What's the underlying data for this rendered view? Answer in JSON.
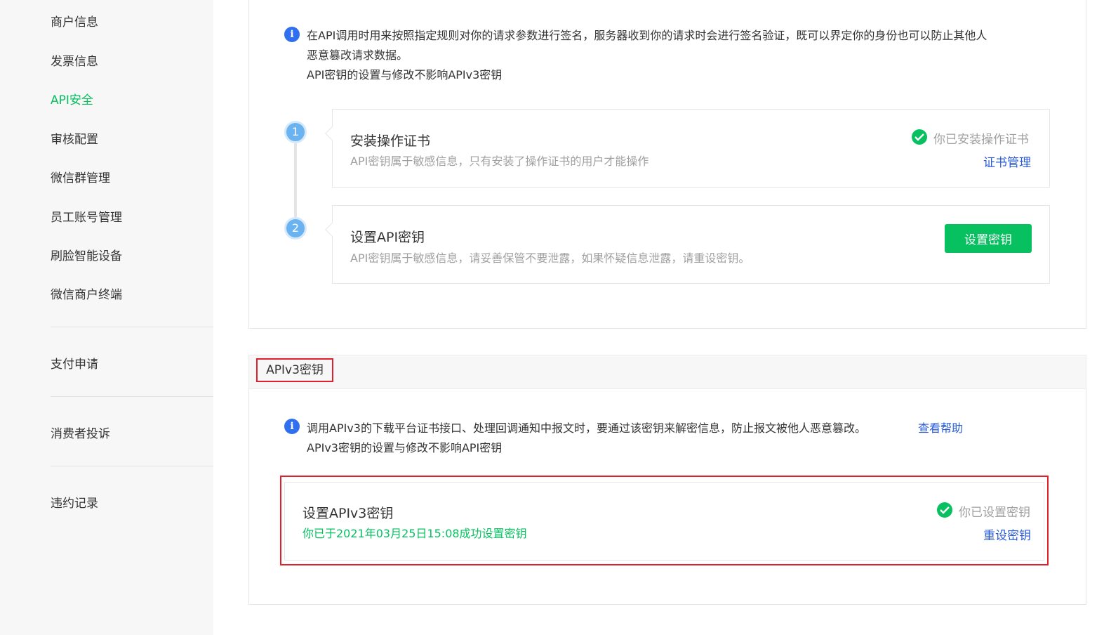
{
  "sidebar": {
    "items": [
      {
        "label": "商户信息",
        "active": false
      },
      {
        "label": "发票信息",
        "active": false
      },
      {
        "label": "API安全",
        "active": true
      },
      {
        "label": "审核配置",
        "active": false
      },
      {
        "label": "微信群管理",
        "active": false
      },
      {
        "label": "员工账号管理",
        "active": false
      },
      {
        "label": "刷脸智能设备",
        "active": false
      },
      {
        "label": "微信商户终端",
        "active": false
      },
      {
        "label": "支付申请",
        "active": false
      },
      {
        "label": "消费者投诉",
        "active": false
      },
      {
        "label": "违约记录",
        "active": false
      }
    ]
  },
  "api_key": {
    "info_line1": "在API调用时用来按照指定规则对你的请求参数进行签名，服务器收到你的请求时会进行签名验证，既可以界定你的身份也可以防止其他人",
    "info_line2": "恶意篡改请求数据。",
    "info_line3": "API密钥的设置与修改不影响APIv3密钥",
    "steps": [
      {
        "number": "1",
        "title": "安装操作证书",
        "desc": "API密钥属于敏感信息，只有安装了操作证书的用户才能操作",
        "status": "你已安装操作证书",
        "action": "证书管理"
      },
      {
        "number": "2",
        "title": "设置API密钥",
        "desc": "API密钥属于敏感信息，请妥善保管不要泄露，如果怀疑信息泄露，请重设密钥。",
        "action": "设置密钥"
      }
    ]
  },
  "apiv3": {
    "section_title": "APIv3密钥",
    "info_line1": "调用APIv3的下载平台证书接口、处理回调通知中报文时，要通过该密钥来解密信息，防止报文被他人恶意篡改。",
    "help_link": "查看帮助",
    "info_line2": "APIv3密钥的设置与修改不影响API密钥",
    "card_title": "设置APIv3密钥",
    "card_desc": "你已于2021年03月25日15:08成功设置密钥",
    "status": "你已设置密钥",
    "action": "重设密钥"
  },
  "colors": {
    "accent_green": "#07c160",
    "link_blue": "#2a5bd7",
    "info_blue": "#2f6ff0",
    "highlight_red": "#e0202a"
  },
  "icons": {
    "info": "info-circle-icon",
    "check": "check-circle-icon"
  }
}
